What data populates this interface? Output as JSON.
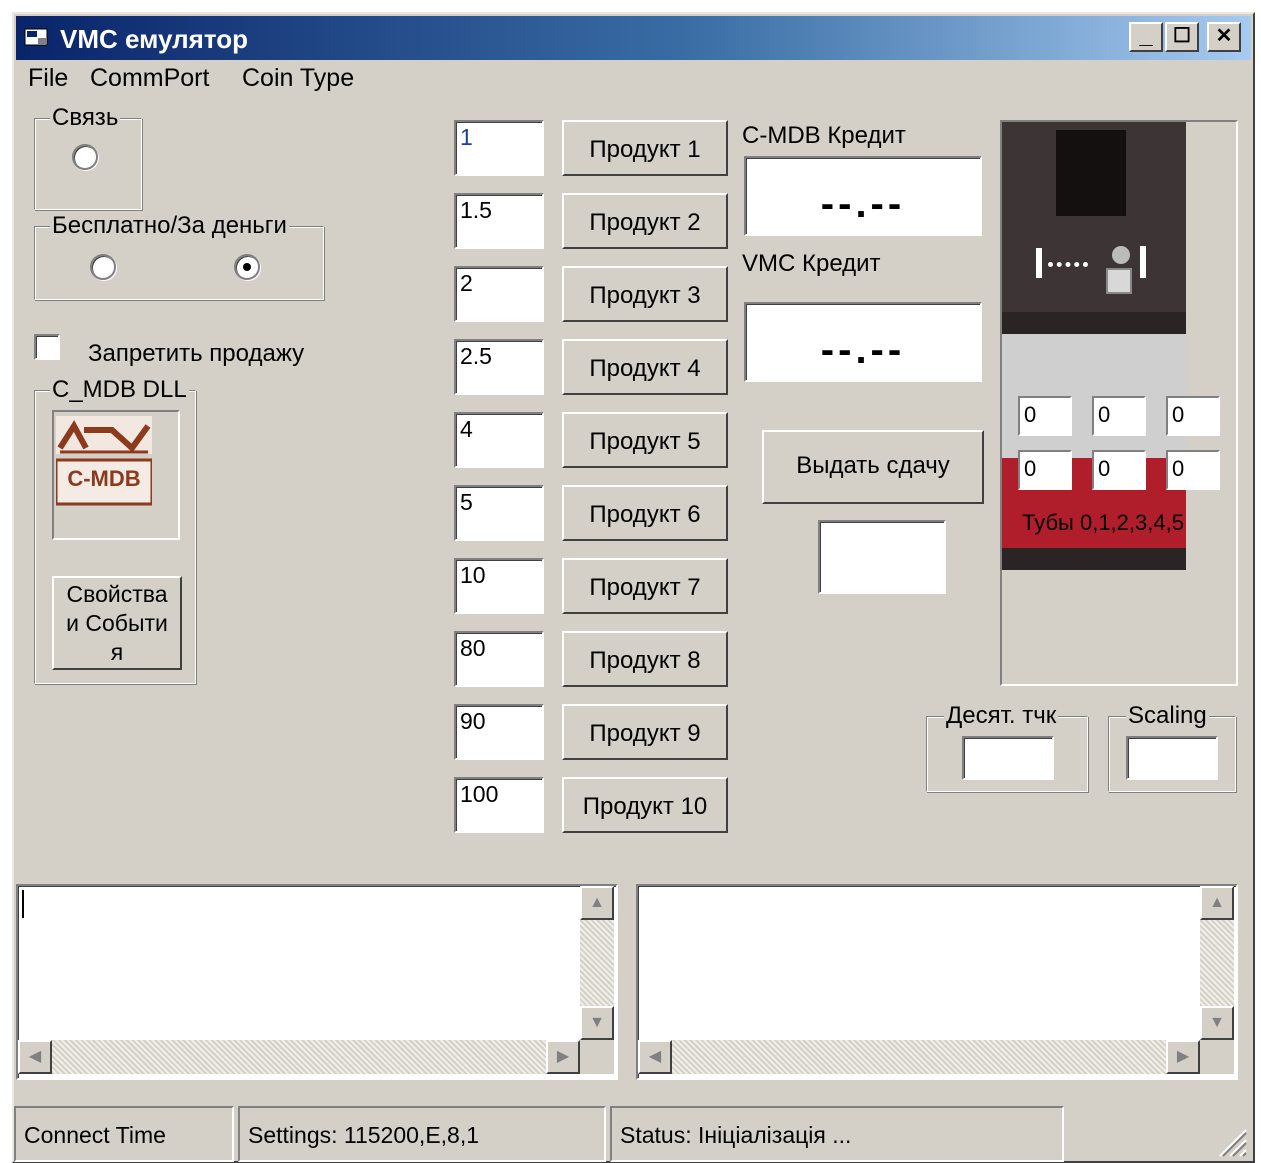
{
  "window": {
    "title": "VMC емулятор",
    "controls": {
      "minimize": "_",
      "maximize": "☐",
      "close": "✕"
    }
  },
  "menu": [
    "File",
    "CommPort",
    "Coin Type"
  ],
  "connection": {
    "label": "Связь"
  },
  "payment_mode": {
    "label": "Бесплатно/За деньги",
    "selected": "second"
  },
  "forbid_sale": {
    "label": "Запретить продажу",
    "checked": false
  },
  "dll": {
    "label": "C_MDB DLL",
    "logo_text": "C-MDB",
    "button_label": "Свойства и События"
  },
  "products": [
    {
      "price": "1",
      "label": "Продукт 1"
    },
    {
      "price": "1.5",
      "label": "Продукт 2"
    },
    {
      "price": "2",
      "label": "Продукт 3"
    },
    {
      "price": "2.5",
      "label": "Продукт 4"
    },
    {
      "price": "4",
      "label": "Продукт 5"
    },
    {
      "price": "5",
      "label": "Продукт 6"
    },
    {
      "price": "10",
      "label": "Продукт 7"
    },
    {
      "price": "80",
      "label": "Продукт 8"
    },
    {
      "price": "90",
      "label": "Продукт 9"
    },
    {
      "price": "100",
      "label": "Продукт 10"
    }
  ],
  "credits": {
    "cmdb_label": "C-MDB Кредит",
    "cmdb_value": "--.--",
    "vmc_label": "VMC Кредит",
    "vmc_value": "--.--"
  },
  "change_button": {
    "label": "Выдать сдачу",
    "value": ""
  },
  "tubes": {
    "values_row1": [
      "0",
      "0",
      "0"
    ],
    "values_row2": [
      "0",
      "0",
      "0"
    ],
    "label": "Тубы 0,1,2,3,4,5"
  },
  "decimal_point": {
    "label": "Десят. тчк",
    "value": ""
  },
  "scaling": {
    "label": "Scaling",
    "value": ""
  },
  "status_bar": {
    "connect_time": "Connect Time",
    "settings": "Settings: 115200,E,8,1",
    "status": "Status: Ініціалізація ..."
  },
  "colors": {
    "window_bg": "#d4d0c8",
    "title_start": "#0a246a",
    "title_end": "#a6caf0",
    "device_dark": "#3d3535",
    "device_red": "#b01e2c",
    "device_gray": "#cfcfcf",
    "logo_brown": "#8b3a1e"
  }
}
